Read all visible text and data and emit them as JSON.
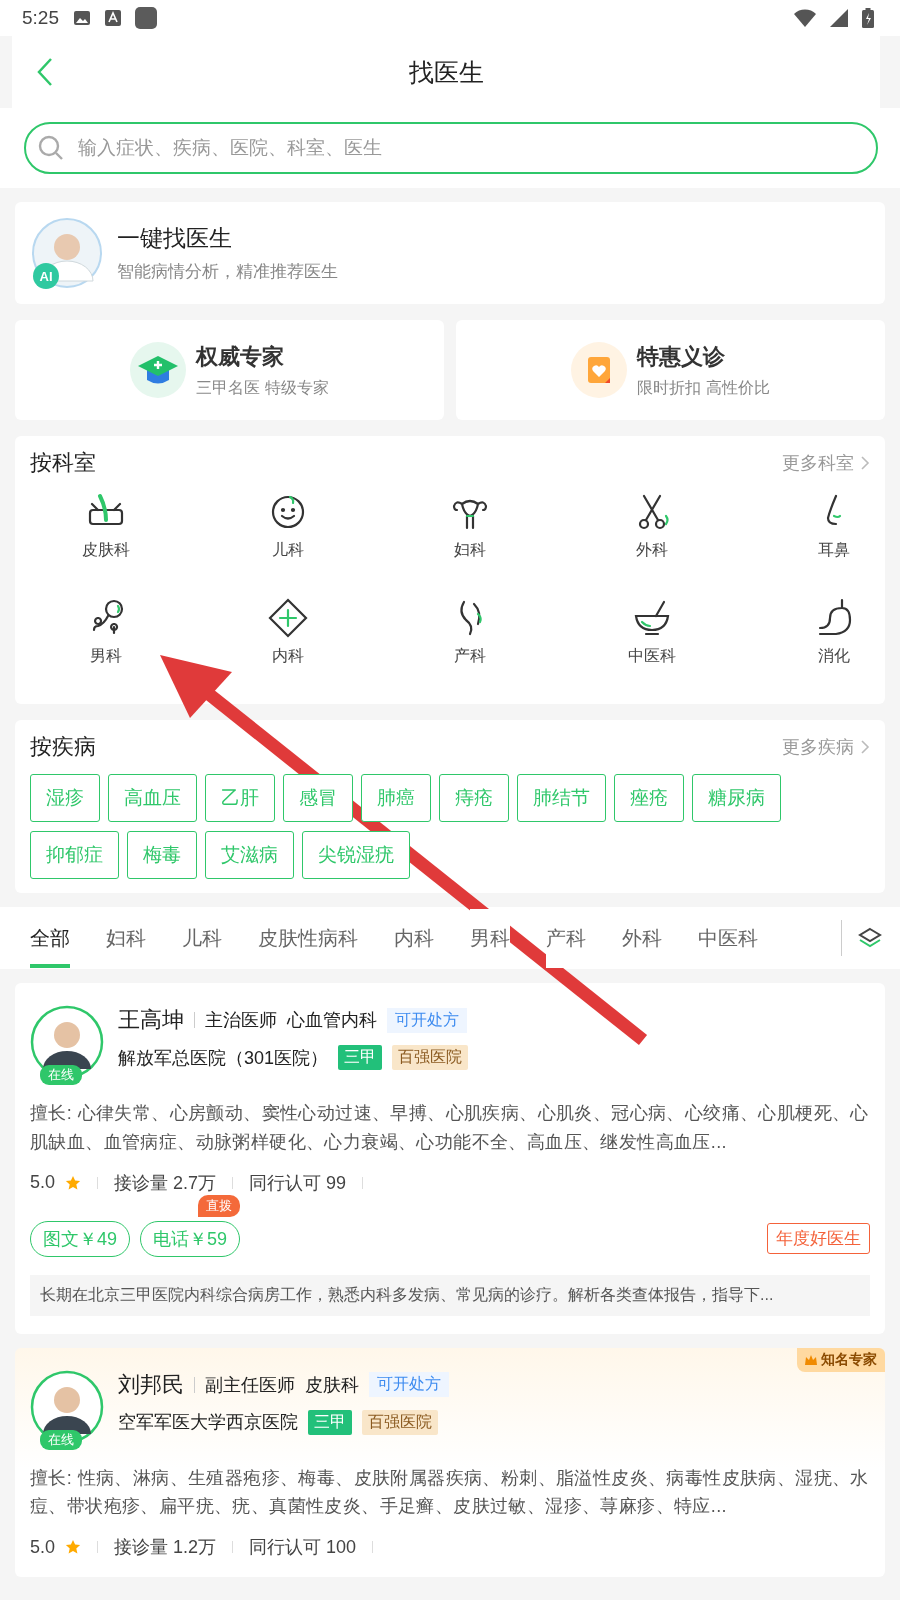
{
  "status_bar": {
    "time": "5:25"
  },
  "header": {
    "title": "找医生"
  },
  "search": {
    "placeholder": "输入症状、疾病、医院、科室、医生"
  },
  "ai_card": {
    "title": "一键找医生",
    "subtitle": "智能病情分析，精准推荐医生",
    "badge": "AI"
  },
  "promos": [
    {
      "title": "权威专家",
      "subtitle": "三甲名医 特级专家",
      "kind": "expert"
    },
    {
      "title": "特惠义诊",
      "subtitle": "限时折扣 高性价比",
      "kind": "discount"
    }
  ],
  "departments": {
    "title": "按科室",
    "more": "更多科室",
    "items": [
      {
        "label": "皮肤科",
        "kind": "skin"
      },
      {
        "label": "儿科",
        "kind": "child"
      },
      {
        "label": "妇科",
        "kind": "uterus"
      },
      {
        "label": "外科",
        "kind": "scissors"
      },
      {
        "label": "耳鼻",
        "kind": "nose"
      },
      {
        "label": "男科",
        "kind": "male"
      },
      {
        "label": "内科",
        "kind": "plus"
      },
      {
        "label": "产科",
        "kind": "pregnant"
      },
      {
        "label": "中医科",
        "kind": "mortar"
      },
      {
        "label": "消化",
        "kind": "stomach"
      }
    ]
  },
  "diseases": {
    "title": "按疾病",
    "more": "更多疾病",
    "items": [
      "湿疹",
      "高血压",
      "乙肝",
      "感冒",
      "肺癌",
      "痔疮",
      "肺结节",
      "痤疮",
      "糖尿病",
      "抑郁症",
      "梅毒",
      "艾滋病",
      "尖锐湿疣"
    ]
  },
  "filter_tabs": [
    {
      "label": "全部",
      "selected": true
    },
    {
      "label": "妇科",
      "selected": false
    },
    {
      "label": "儿科",
      "selected": false
    },
    {
      "label": "皮肤性病科",
      "selected": false
    },
    {
      "label": "内科",
      "selected": false
    },
    {
      "label": "男科",
      "selected": false
    },
    {
      "label": "产科",
      "selected": false
    },
    {
      "label": "外科",
      "selected": false
    },
    {
      "label": "中医科",
      "selected": false
    }
  ],
  "doctors": [
    {
      "name": "王高坤",
      "title": "主治医师",
      "department": "心血管内科",
      "rx": "可开处方",
      "online": "在线",
      "hospital": "解放军总医院（301医院）",
      "tags": [
        {
          "label": "三甲",
          "kind": "grade"
        },
        {
          "label": "百强医院",
          "kind": "rank"
        }
      ],
      "specialty": "擅长: 心律失常、心房颤动、窦性心动过速、早搏、心肌疾病、心肌炎、冠心病、心绞痛、心肌梗死、心肌缺血、血管病症、动脉粥样硬化、心力衰竭、心功能不全、高血压、继发性高血压...",
      "rating": "5.0",
      "consults": "接诊量 2.7万",
      "peers": "同行认可 99",
      "services": [
        {
          "label": "图文￥49"
        },
        {
          "label": "电话￥59",
          "flag": "直拨"
        }
      ],
      "award": "年度好医生",
      "intro": "长期在北京三甲医院内科综合病房工作，熟悉内科多发病、常见病的诊疗。解析各类查体报告，指导下..."
    },
    {
      "name": "刘邦民",
      "title": "副主任医师",
      "department": "皮肤科",
      "rx": "可开处方",
      "online": "在线",
      "hospital": "空军军医大学西京医院",
      "tags": [
        {
          "label": "三甲",
          "kind": "grade"
        },
        {
          "label": "百强医院",
          "kind": "rank"
        }
      ],
      "specialty": "擅长: 性病、淋病、生殖器疱疹、梅毒、皮肤附属器疾病、粉刺、脂溢性皮炎、病毒性皮肤病、湿疣、水痘、带状疱疹、扁平疣、疣、真菌性皮炎、手足癣、皮肤过敏、湿疹、荨麻疹、特应...",
      "rating": "5.0",
      "consults": "接诊量 1.2万",
      "peers": "同行认可 100",
      "ribbon": "知名专家"
    }
  ]
}
